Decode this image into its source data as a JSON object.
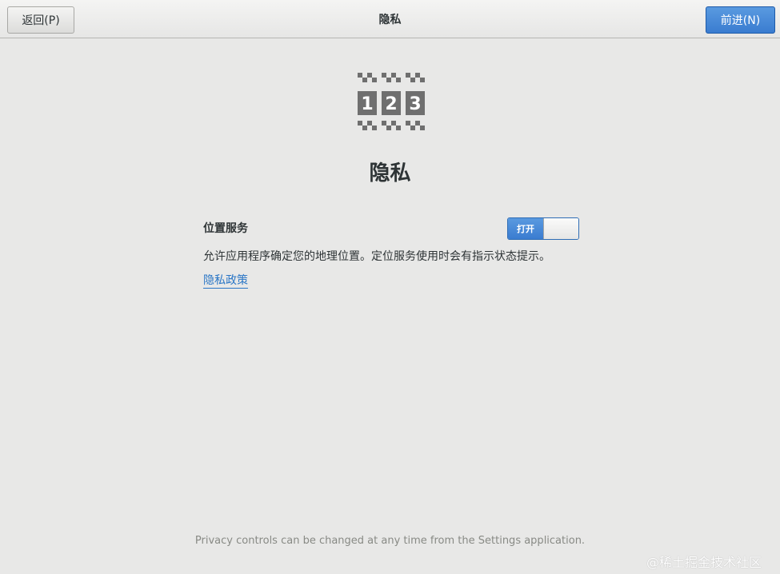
{
  "header": {
    "back_label": "返回(P)",
    "title": "隐私",
    "next_label": "前进(N)"
  },
  "logo": {
    "icon": "initial-setup-123-icon",
    "digits": [
      "1",
      "2",
      "3"
    ]
  },
  "main": {
    "title": "隐私",
    "location": {
      "label": "位置服务",
      "switch_on_label": "打开",
      "switch_state": "on",
      "description": "允许应用程序确定您的地理位置。定位服务使用时会有指示状态提示。"
    },
    "policy_link": "隐私政策"
  },
  "footer": {
    "note": "Privacy controls can be changed at any time from the Settings application."
  },
  "watermark": "@稀土掘金技术社区",
  "colors": {
    "accent": "#3a7cd0",
    "link": "#2a76c6",
    "background": "#e8e8e7"
  }
}
